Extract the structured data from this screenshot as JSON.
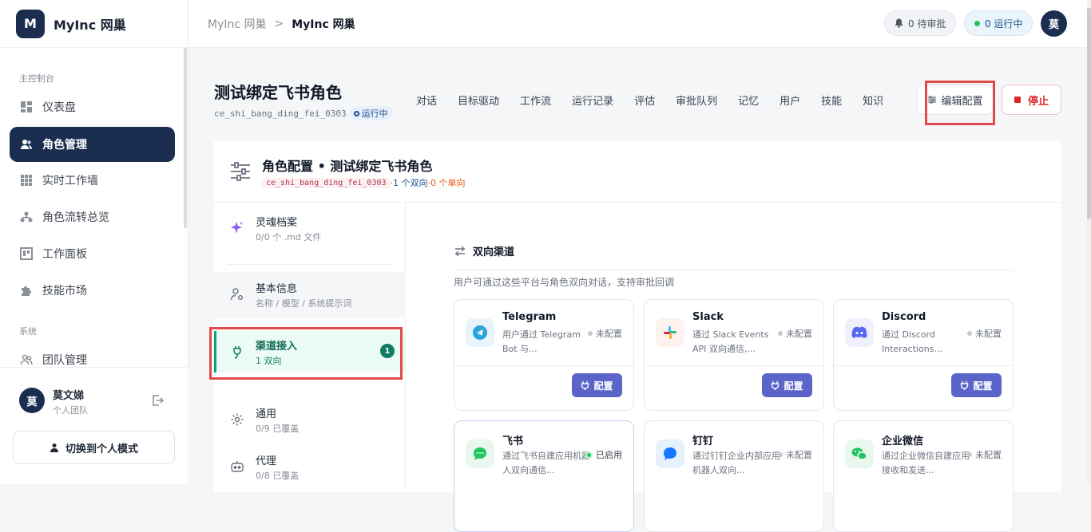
{
  "brand": {
    "logo": "M",
    "name": "MyInc 网巢"
  },
  "sidebar": {
    "section_main": "主控制台",
    "items": [
      {
        "label": "仪表盘",
        "icon": "dashboard-icon"
      },
      {
        "label": "角色管理",
        "icon": "users-icon"
      },
      {
        "label": "实时工作墙",
        "icon": "grid-icon"
      },
      {
        "label": "角色流转总览",
        "icon": "flow-icon"
      },
      {
        "label": "工作面板",
        "icon": "board-icon"
      },
      {
        "label": "技能市场",
        "icon": "puzzle-icon"
      }
    ],
    "section_system": "系统",
    "system_items": [
      {
        "label": "团队管理",
        "icon": "team-icon"
      }
    ]
  },
  "user": {
    "avatar": "莫",
    "name": "莫文娣",
    "team": "个人团队",
    "switch_label": "切换到个人模式"
  },
  "topbar": {
    "crumb_parent": "MyInc 网巢",
    "crumb_sep": ">",
    "crumb_current": "MyInc 网巢",
    "approvals": "0 待审批",
    "running": "0 运行中",
    "avatar": "莫"
  },
  "role": {
    "title": "测试绑定飞书角色",
    "slug": "ce_shi_bang_ding_fei_0303",
    "status": "运行中"
  },
  "tabs": [
    "对话",
    "目标驱动",
    "工作流",
    "运行记录",
    "评估",
    "审批队列",
    "记忆",
    "用户",
    "技能",
    "知识"
  ],
  "actions": {
    "edit": "编辑配置",
    "stop": "停止"
  },
  "config": {
    "title": "角色配置 • 测试绑定飞书角色",
    "slug": "ce_shi_bang_ding_fei_0303",
    "sep1": " · ",
    "bidir": "1 个双向",
    "sep2": " · ",
    "unidir": "0 个单向"
  },
  "left_menu": [
    {
      "title": "灵魂档案",
      "sub": "0/0 个 .md 文件",
      "icon": "sparkle-icon"
    },
    {
      "title": "基本信息",
      "sub": "名称 / 模型 / 系统提示词",
      "icon": "user-gear-icon"
    },
    {
      "title": "渠道接入",
      "sub": "1 双向",
      "badge": "1",
      "icon": "plug-icon"
    },
    {
      "title": "通用",
      "sub": "0/9 已覆盖",
      "icon": "settings-icon"
    },
    {
      "title": "代理",
      "sub": "0/8 已覆盖",
      "icon": "robot-icon"
    }
  ],
  "channels": {
    "title": "双向渠道",
    "desc": "用户可通过这些平台与角色双向对话，支持审批回调",
    "items": [
      {
        "name": "Telegram",
        "desc": "用户通过 Telegram Bot 与...",
        "status": "未配置",
        "button": "配置",
        "icon": "telegram-icon",
        "color": "#2aa3db"
      },
      {
        "name": "Slack",
        "desc": "通过 Slack Events API 双向通信,...",
        "status": "未配置",
        "button": "配置",
        "icon": "slack-icon",
        "color": "#e01e5a"
      },
      {
        "name": "Discord",
        "desc": "通过 Discord Interactions...",
        "status": "未配置",
        "button": "配置",
        "icon": "discord-icon",
        "color": "#5865f2"
      },
      {
        "name": "飞书",
        "desc": "通过飞书自建应用机器人双向通信...",
        "status": "已启用",
        "icon": "feishu-icon",
        "color": "#22c55e"
      },
      {
        "name": "钉钉",
        "desc": "通过钉钉企业内部应用机器人双向...",
        "status": "未配置",
        "icon": "dingtalk-icon",
        "color": "#1677ff"
      },
      {
        "name": "企业微信",
        "desc": "通过企业微信自建应用接收和发送...",
        "status": "未配置",
        "icon": "wecom-icon",
        "color": "#22c55e"
      }
    ]
  }
}
